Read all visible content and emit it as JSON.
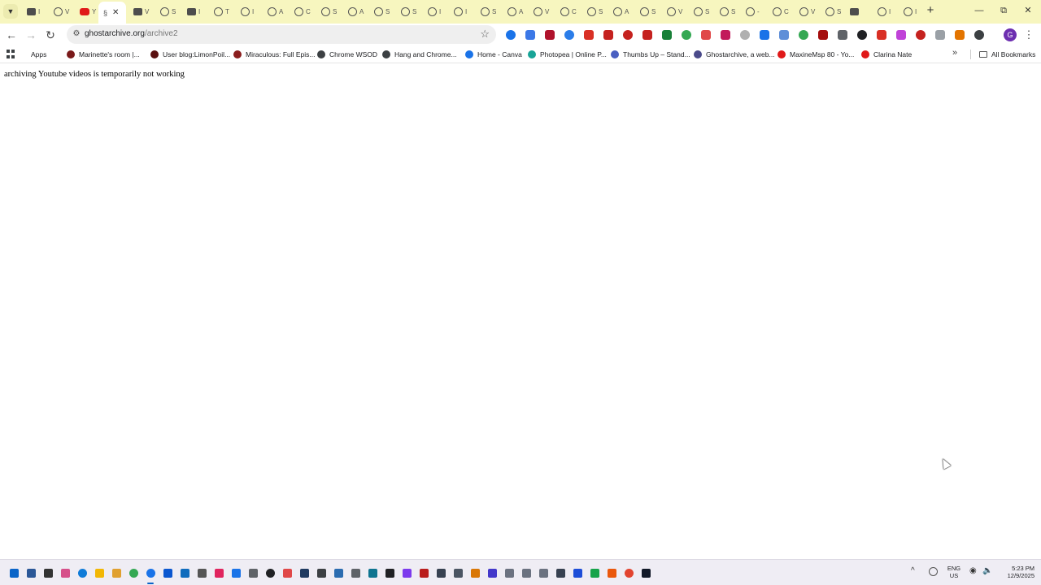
{
  "browser": {
    "tab_strip": {
      "tab_search_icon": "chevron-down-icon",
      "tabs": [
        {
          "favicon": "folder",
          "title": "I"
        },
        {
          "favicon": "globe",
          "title": "V"
        },
        {
          "favicon": "youtube",
          "title": "Y"
        },
        {
          "favicon": "folder",
          "title": "V"
        },
        {
          "favicon": "globe",
          "title": "S"
        },
        {
          "favicon": "folder",
          "title": "I"
        },
        {
          "favicon": "globe",
          "title": "T"
        },
        {
          "favicon": "globe",
          "title": "I"
        },
        {
          "favicon": "globe",
          "title": "A"
        },
        {
          "favicon": "globe",
          "title": "C"
        },
        {
          "favicon": "globe",
          "title": "S"
        },
        {
          "favicon": "globe",
          "title": "A"
        },
        {
          "favicon": "globe",
          "title": "S"
        },
        {
          "favicon": "globe",
          "title": "S"
        },
        {
          "favicon": "globe",
          "title": "I"
        },
        {
          "favicon": "globe",
          "title": "I"
        },
        {
          "favicon": "globe",
          "title": "S"
        },
        {
          "favicon": "globe",
          "title": "A"
        },
        {
          "favicon": "globe",
          "title": "V"
        },
        {
          "favicon": "globe",
          "title": "C"
        },
        {
          "favicon": "globe",
          "title": "S"
        },
        {
          "favicon": "globe",
          "title": "A"
        },
        {
          "favicon": "globe",
          "title": "S"
        },
        {
          "favicon": "globe",
          "title": "V"
        },
        {
          "favicon": "globe",
          "title": "S"
        },
        {
          "favicon": "globe",
          "title": "S"
        },
        {
          "favicon": "globe",
          "title": "-"
        },
        {
          "favicon": "globe",
          "title": "C"
        },
        {
          "favicon": "globe",
          "title": "V"
        },
        {
          "favicon": "globe",
          "title": "S"
        },
        {
          "favicon": "folder",
          "title": ""
        },
        {
          "favicon": "globe",
          "title": "I"
        },
        {
          "favicon": "globe",
          "title": "I"
        }
      ],
      "active_tab": {
        "favicon_text": "§",
        "close": "✕"
      },
      "new_tab": "+",
      "window_controls": {
        "minimize": "—",
        "restore": "⧉",
        "close": "✕"
      }
    },
    "toolbar": {
      "back": "←",
      "forward": "→",
      "reload": "↻",
      "url_host": "ghostarchive.org",
      "url_path": "/archive2",
      "star": "☆",
      "extensions": [
        {
          "name": "ext-1",
          "color": "#1a73e8"
        },
        {
          "name": "ext-2",
          "color": "#3b78e7"
        },
        {
          "name": "ext-3",
          "color": "#b0122c"
        },
        {
          "name": "ext-4",
          "color": "#2b7de9"
        },
        {
          "name": "ext-5",
          "color": "#d93025"
        },
        {
          "name": "ext-6",
          "color": "#c5221f"
        },
        {
          "name": "ext-7",
          "color": "#c5221f"
        },
        {
          "name": "ext-8",
          "color": "#c5221f"
        },
        {
          "name": "ext-9",
          "color": "#188038"
        },
        {
          "name": "ext-10",
          "color": "#34a853"
        },
        {
          "name": "ext-11",
          "color": "#e04848"
        },
        {
          "name": "ext-12",
          "color": "#c2185b"
        },
        {
          "name": "ext-13",
          "color": "#b0b0b0"
        },
        {
          "name": "ext-14",
          "color": "#1a73e8"
        },
        {
          "name": "ext-15",
          "color": "#5f8fd8"
        },
        {
          "name": "ext-16",
          "color": "#34a853"
        },
        {
          "name": "ext-17",
          "color": "#a50e0e"
        },
        {
          "name": "ext-18",
          "color": "#5f6368"
        },
        {
          "name": "ext-19",
          "color": "#202124"
        },
        {
          "name": "ext-20",
          "color": "#d93025"
        },
        {
          "name": "ext-21",
          "color": "#c043d8"
        },
        {
          "name": "ext-22",
          "color": "#c5221f"
        },
        {
          "name": "ext-23",
          "color": "#9aa0a6"
        },
        {
          "name": "ext-24",
          "color": "#e37400"
        },
        {
          "name": "puzzle",
          "color": "#3c4043"
        }
      ],
      "profile_initial": "G",
      "menu": "⋮"
    },
    "bookmarks": {
      "apps_label": "Apps",
      "items": [
        {
          "label": "Marinette's room |...",
          "color": "#7a1a1a"
        },
        {
          "label": "User blog:LimonPoil...",
          "color": "#5a1010"
        },
        {
          "label": "Miraculous: Full Epis...",
          "color": "#8b1e1e"
        },
        {
          "label": "Chrome WSOD",
          "color": "#3c4043"
        },
        {
          "label": "Hang and Chrome...",
          "color": "#3c4043"
        },
        {
          "label": "Home - Canva",
          "color": "#1a73e8"
        },
        {
          "label": "Photopea | Online P...",
          "color": "#18a497"
        },
        {
          "label": "Thumbs Up – Stand...",
          "color": "#4a5fc1"
        },
        {
          "label": "Ghostarchive, a web...",
          "color": "#4a4a8a"
        },
        {
          "label": "MaxineMsp 80 - Yo...",
          "color": "#e01919"
        },
        {
          "label": "Clarina Nate",
          "color": "#e01919"
        }
      ],
      "more": "»",
      "all_bookmarks": "All Bookmarks"
    }
  },
  "page": {
    "message": "archiving Youtube videos is temporarily not working"
  },
  "taskbar": {
    "apps": [
      {
        "name": "start",
        "color": "#0a64c8"
      },
      {
        "name": "search",
        "color": "#2b5797"
      },
      {
        "name": "task-view",
        "color": "#333333"
      },
      {
        "name": "app-4",
        "color": "#d6508a"
      },
      {
        "name": "edge",
        "color": "#0f7bd8"
      },
      {
        "name": "file-explorer",
        "color": "#f2b705"
      },
      {
        "name": "app-7",
        "color": "#e0a030"
      },
      {
        "name": "chrome",
        "color": "#34a853"
      },
      {
        "name": "chrome-active",
        "color": "#1a73e8"
      },
      {
        "name": "app-10",
        "color": "#0b57d0"
      },
      {
        "name": "outlook",
        "color": "#0f6cbd"
      },
      {
        "name": "app-12",
        "color": "#555555"
      },
      {
        "name": "app-13",
        "color": "#e0245e"
      },
      {
        "name": "app-14",
        "color": "#1a73e8"
      },
      {
        "name": "app-15",
        "color": "#5f6368"
      },
      {
        "name": "media",
        "color": "#202124"
      },
      {
        "name": "app-17",
        "color": "#e04848"
      },
      {
        "name": "app-18",
        "color": "#1f3a60"
      },
      {
        "name": "notepad",
        "color": "#3c4043"
      },
      {
        "name": "app-20",
        "color": "#2b6cb0"
      },
      {
        "name": "app-21",
        "color": "#5f6368"
      },
      {
        "name": "app-22",
        "color": "#0e7490"
      },
      {
        "name": "app-23",
        "color": "#202124"
      },
      {
        "name": "app-24",
        "color": "#7c3aed"
      },
      {
        "name": "app-25",
        "color": "#b91c1c"
      },
      {
        "name": "app-26",
        "color": "#374151"
      },
      {
        "name": "settings",
        "color": "#4b5563"
      },
      {
        "name": "app-28",
        "color": "#d97706"
      },
      {
        "name": "app-29",
        "color": "#4338ca"
      },
      {
        "name": "app-30",
        "color": "#6b7280"
      },
      {
        "name": "app-31",
        "color": "#6b7280"
      },
      {
        "name": "app-32",
        "color": "#6b7280"
      },
      {
        "name": "app-33",
        "color": "#374151"
      },
      {
        "name": "app-34",
        "color": "#1d4ed8"
      },
      {
        "name": "app-35",
        "color": "#16a34a"
      },
      {
        "name": "app-36",
        "color": "#ea580c"
      },
      {
        "name": "brave",
        "color": "#e2442f"
      },
      {
        "name": "app-38",
        "color": "#111827"
      }
    ],
    "tray": {
      "show_hidden": "^",
      "lang_line1": "ENG",
      "lang_line2": "US",
      "time": "5:23 PM",
      "date": "12/9/2025"
    }
  }
}
